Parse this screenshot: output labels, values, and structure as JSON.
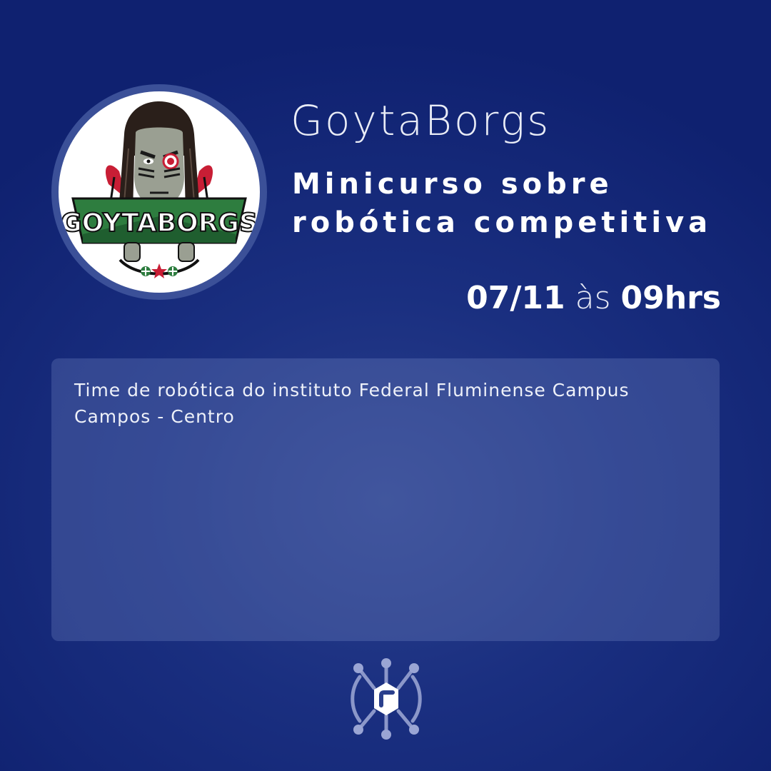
{
  "team": {
    "name": "GoytaBorgs",
    "logo_text": "GOYTABORGS"
  },
  "course": {
    "title_line1": "Minicurso sobre",
    "title_line2": "robótica competitiva"
  },
  "schedule": {
    "date": "07/11",
    "connector": "às",
    "time": "09hrs"
  },
  "description": {
    "text": "Time de robótica do instituto Federal Fluminense Campus Campos - Centro"
  },
  "icons": {
    "footer": "network-hub-icon",
    "logo": "goytaborgs-team-logo"
  },
  "colors": {
    "background": "#1a2f80",
    "logo_green": "#2e7d3f",
    "logo_red": "#c81e35",
    "box": "#3a4e92"
  }
}
